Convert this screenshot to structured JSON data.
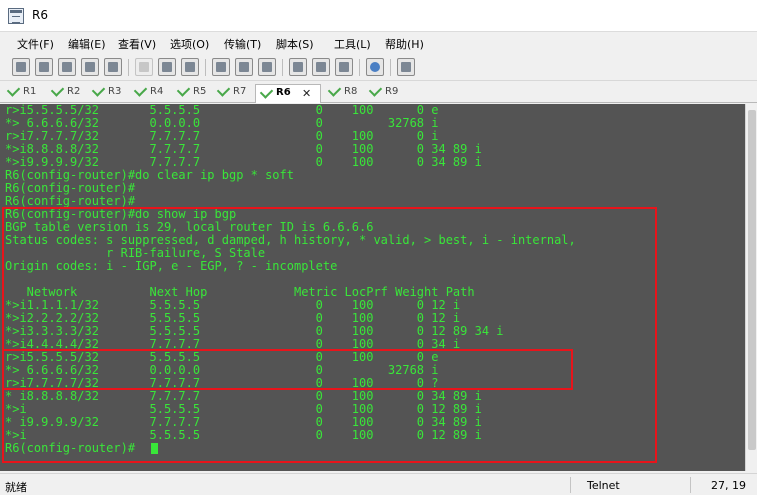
{
  "window": {
    "title": "R6"
  },
  "menu": [
    "文件(F)",
    "编辑(E)",
    "查看(V)",
    "选项(O)",
    "传输(T)",
    "脚本(S)",
    "工具(L)",
    "帮助(H)"
  ],
  "tabs": [
    {
      "label": "R1",
      "active": false
    },
    {
      "label": "R2",
      "active": false
    },
    {
      "label": "R3",
      "active": false
    },
    {
      "label": "R4",
      "active": false
    },
    {
      "label": "R5",
      "active": false
    },
    {
      "label": "R7",
      "active": false
    },
    {
      "label": "R6",
      "active": true
    },
    {
      "label": "R8",
      "active": false
    },
    {
      "label": "R9",
      "active": false
    }
  ],
  "tab_close_glyph": "✕",
  "terminal": {
    "lines": [
      "r>i5.5.5.5/32       5.5.5.5                0    100      0 e",
      "*> 6.6.6.6/32       0.0.0.0                0         32768 i",
      "r>i7.7.7.7/32       7.7.7.7                0    100      0 i",
      "*>i8.8.8.8/32       7.7.7.7                0    100      0 34 89 i",
      "*>i9.9.9.9/32       7.7.7.7                0    100      0 34 89 i",
      "R6(config-router)#do clear ip bgp * soft",
      "R6(config-router)#",
      "R6(config-router)#",
      "R6(config-router)#do show ip bgp",
      "BGP table version is 29, local router ID is 6.6.6.6",
      "Status codes: s suppressed, d damped, h history, * valid, > best, i - internal,",
      "              r RIB-failure, S Stale",
      "Origin codes: i - IGP, e - EGP, ? - incomplete",
      "",
      "   Network          Next Hop            Metric LocPrf Weight Path",
      "*>i1.1.1.1/32       5.5.5.5                0    100      0 12 i",
      "*>i2.2.2.2/32       5.5.5.5                0    100      0 12 i",
      "*>i3.3.3.3/32       5.5.5.5                0    100      0 12 89 34 i",
      "*>i4.4.4.4/32       7.7.7.7                0    100      0 34 i",
      "r>i5.5.5.5/32       5.5.5.5                0    100      0 e",
      "*> 6.6.6.6/32       0.0.0.0                0         32768 i",
      "r>i7.7.7.7/32       7.7.7.7                0    100      0 ?",
      "* i8.8.8.8/32       7.7.7.7                0    100      0 34 89 i",
      "*>i                 5.5.5.5                0    100      0 12 89 i",
      "* i9.9.9.9/32       7.7.7.7                0    100      0 34 89 i",
      "*>i                 5.5.5.5                0    100      0 12 89 i",
      "R6(config-router)#"
    ],
    "text_color": "#39e639",
    "background": "#545454",
    "highlight_color": "#e8141b"
  },
  "status": {
    "left": "就绪",
    "protocol": "Telnet",
    "position": "27, 19"
  }
}
